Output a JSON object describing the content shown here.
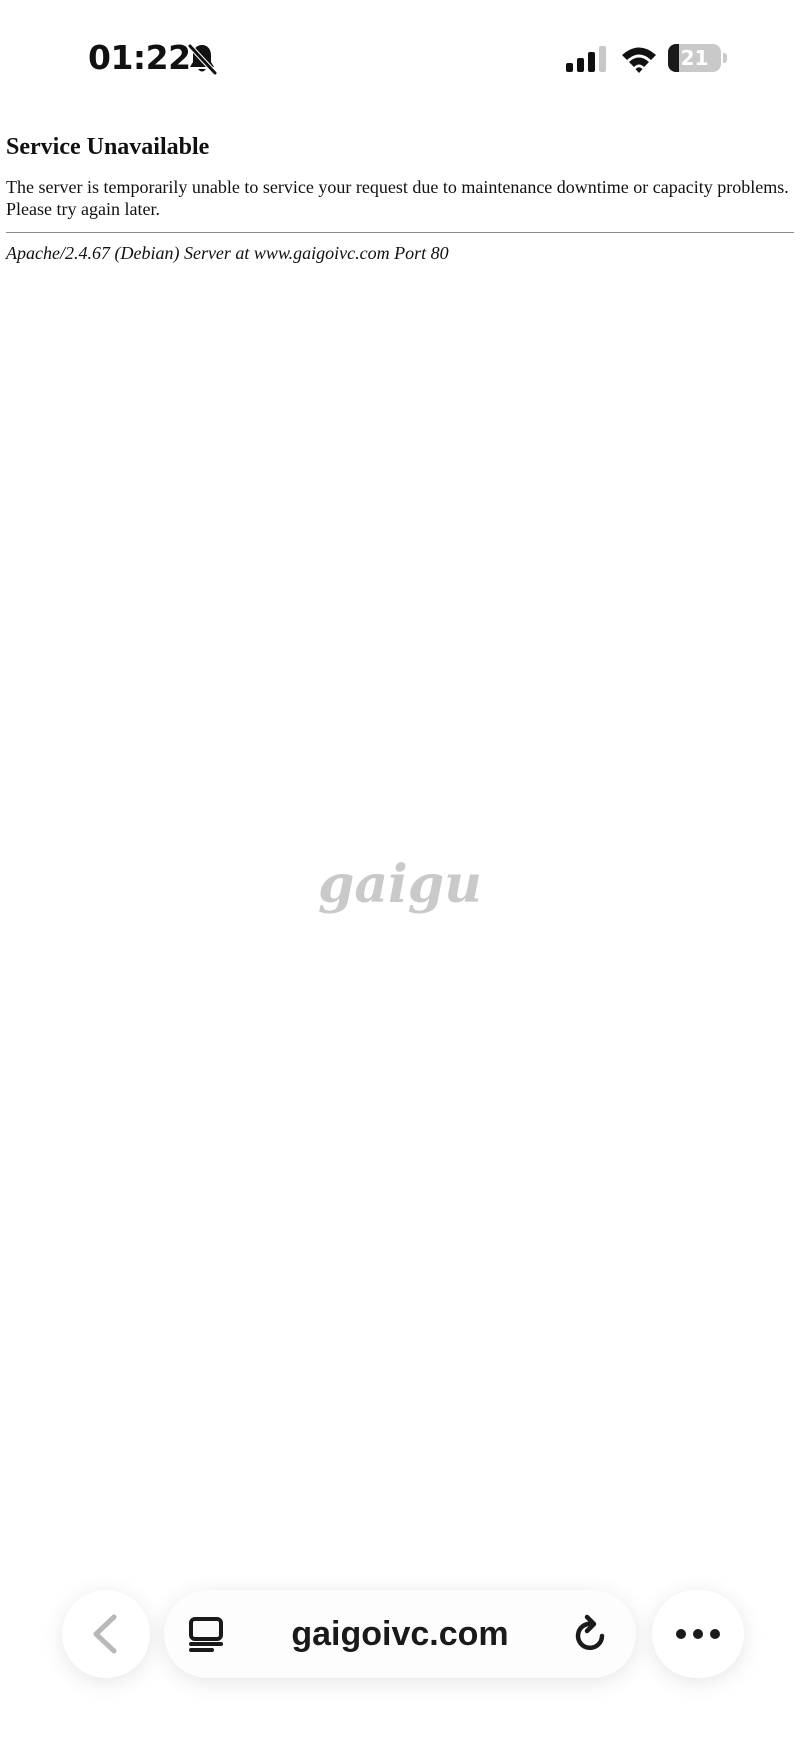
{
  "status_bar": {
    "time": "01:22",
    "battery_level": "21",
    "battery_fraction": 0.21,
    "signal_bars_active": 3,
    "signal_bars_total": 4,
    "icons": [
      "bell-slash-icon",
      "cellular-signal-icon",
      "wifi-icon",
      "battery-icon"
    ]
  },
  "page": {
    "heading": "Service Unavailable",
    "message": "The server is temporarily unable to service your request due to maintenance downtime or capacity problems. Please try again later.",
    "server_signature": "Apache/2.4.67 (Debian) Server at www.gaigoivc.com Port 80"
  },
  "watermark": {
    "text": "gaigu"
  },
  "browser_bar": {
    "url": "gaigoivc.com",
    "icons": [
      "chevron-left-icon",
      "reader-icon",
      "reload-icon",
      "more-icon"
    ]
  },
  "colors": {
    "text": "#111111",
    "watermark": "#c7c7c7",
    "disabled_icon": "#b8b8b8"
  }
}
